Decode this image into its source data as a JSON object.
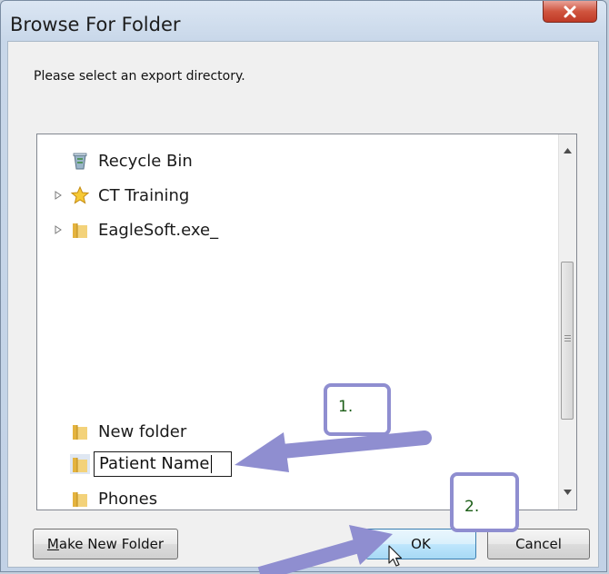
{
  "window": {
    "title": "Browse For Folder"
  },
  "prompt": "Please select an export directory.",
  "tree": {
    "items": [
      {
        "label": "Recycle Bin",
        "icon": "recycle-bin-icon",
        "expandable": false
      },
      {
        "label": "CT Training",
        "icon": "star-folder-icon",
        "expandable": true
      },
      {
        "label": "EagleSoft.exe_",
        "icon": "folder-icon",
        "expandable": true
      },
      {
        "label": "New folder",
        "icon": "folder-icon",
        "expandable": false
      },
      {
        "label": "Patient Name",
        "icon": "folder-icon",
        "expandable": false,
        "editing": true
      },
      {
        "label": "Phones",
        "icon": "folder-icon",
        "expandable": false
      }
    ]
  },
  "buttons": {
    "make_new_folder_mnemonic": "M",
    "make_new_folder_rest": "ake New Folder",
    "ok_label": "OK",
    "cancel_label": "Cancel"
  },
  "annotations": {
    "step1": "1.",
    "step2": "2."
  },
  "colors": {
    "callout_border": "#8f8ed0",
    "arrow": "#8f8ed0",
    "step_text": "#1c5e17"
  }
}
